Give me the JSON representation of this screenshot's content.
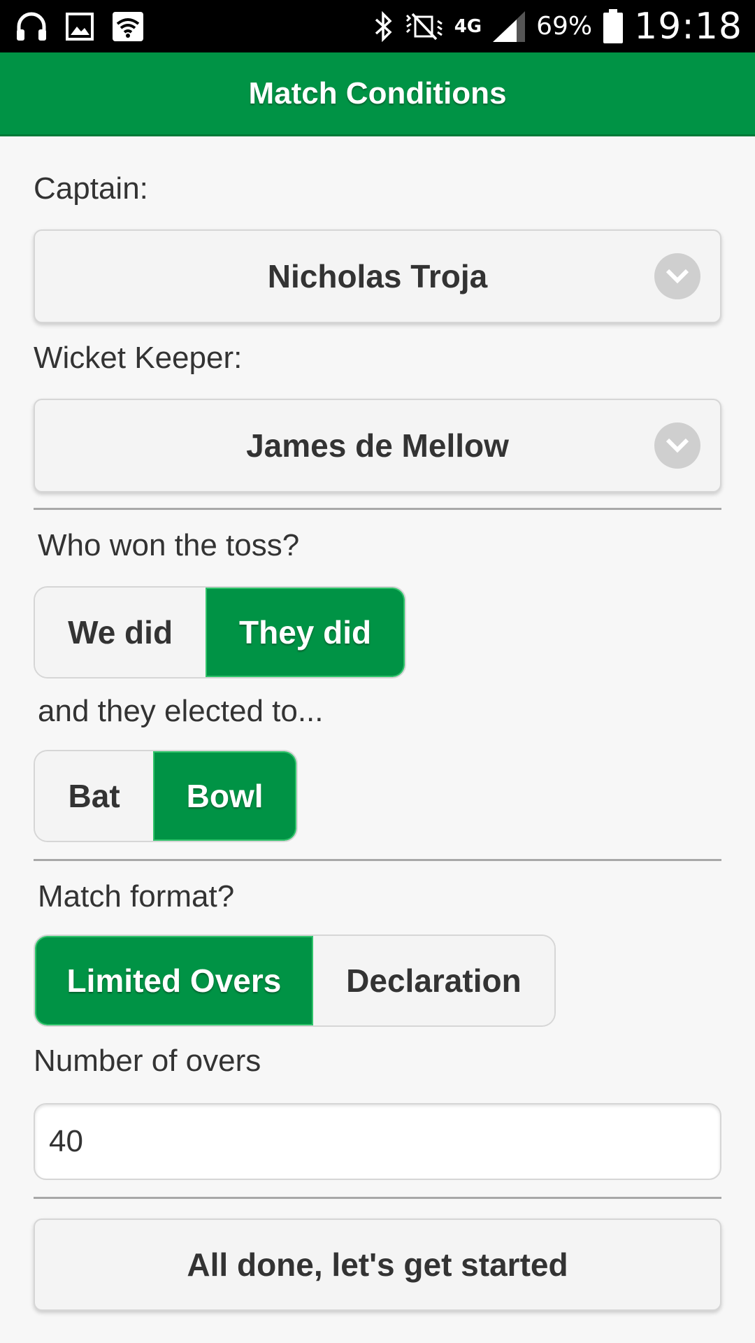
{
  "status_bar": {
    "network_type": "4G",
    "battery_percent": "69%",
    "time": "19:18"
  },
  "header": {
    "title": "Match Conditions"
  },
  "captain": {
    "label": "Captain:",
    "value": "Nicholas Troja"
  },
  "wicket_keeper": {
    "label": "Wicket Keeper:",
    "value": "James de Mellow"
  },
  "toss": {
    "question": "Who won the toss?",
    "options": [
      "We did",
      "They did"
    ],
    "selected": "They did"
  },
  "elected": {
    "question": "and they elected to...",
    "options": [
      "Bat",
      "Bowl"
    ],
    "selected": "Bowl"
  },
  "format": {
    "question": "Match format?",
    "options": [
      "Limited Overs",
      "Declaration"
    ],
    "selected": "Limited Overs"
  },
  "overs": {
    "label": "Number of overs",
    "value": "40"
  },
  "submit": {
    "label": "All done, let's get started"
  },
  "colors": {
    "accent": "#009345",
    "status_bar": "#000000",
    "background": "#f7f7f7"
  },
  "icons": [
    "headphones-icon",
    "image-icon",
    "wifi-box-icon",
    "bluetooth-icon",
    "mute-icon",
    "data-arrows-icon",
    "signal-icon",
    "battery-icon",
    "chevron-down-icon"
  ]
}
